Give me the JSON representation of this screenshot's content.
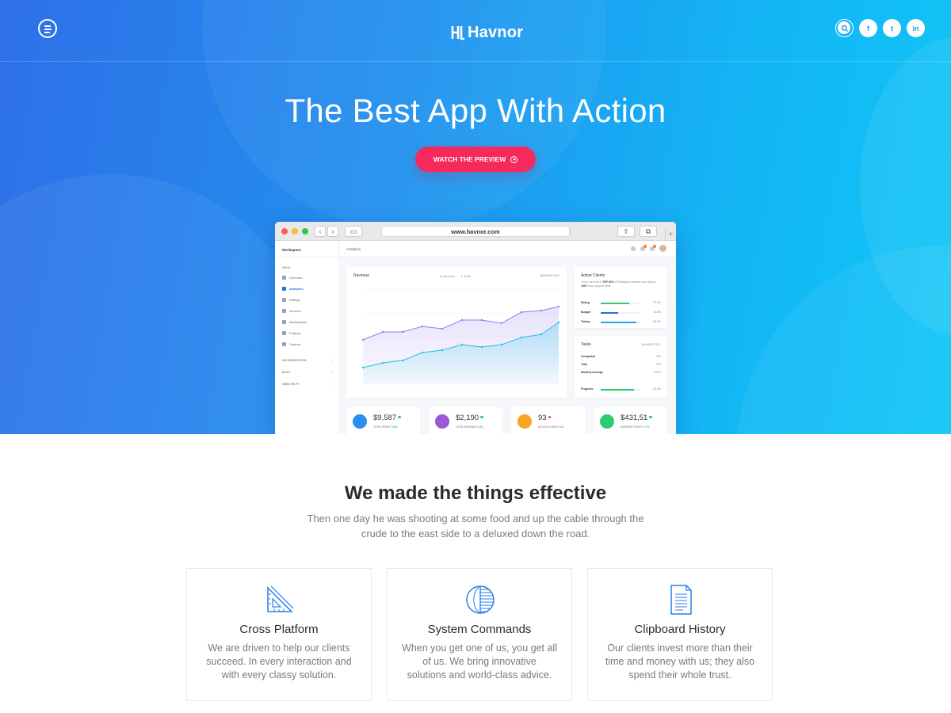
{
  "brand": {
    "name": "Havnor"
  },
  "header": {
    "menu_icon": "hamburger-icon",
    "social": [
      {
        "name": "search",
        "icon": "search-icon",
        "glyph": ""
      },
      {
        "name": "facebook",
        "icon": "facebook-icon",
        "glyph": "f"
      },
      {
        "name": "twitter",
        "icon": "twitter-icon",
        "glyph": "t"
      },
      {
        "name": "linkedin",
        "icon": "linkedin-icon",
        "glyph": "in"
      }
    ]
  },
  "hero": {
    "title": "The Best App With Action",
    "cta_label": "WATCH THE PREVIEW"
  },
  "mockup": {
    "url": "www.havnor.com",
    "workspace": "Workspace",
    "menu_label": "MENU",
    "nav": [
      "Overview",
      "Analytics",
      "Ratings",
      "Invoices",
      "Marketplace",
      "Projects",
      "Support"
    ],
    "active_nav": "Analytics",
    "sections": [
      "DOCUMENTATION",
      "BLOG",
      "NEED HELP?"
    ],
    "page_title": "Analytics",
    "revenue": {
      "title": "Revenue",
      "legend": [
        "Revenue",
        "Profit"
      ],
      "period": "JANUARY 2017"
    },
    "active_clients": {
      "title": "Active Clients",
      "text_pre": "You're currently in",
      "text_bold": "TOP 10%",
      "text_mid": "of Workspace platform your rating is",
      "rating": "4.85",
      "text_post": "Keep up great work!",
      "metrics": [
        {
          "label": "Rating",
          "value": "72.3%",
          "pct": 72.3,
          "color": "#2ecc71"
        },
        {
          "label": "Budget",
          "value": "43.8%",
          "pct": 43.8,
          "color": "#2a6de0"
        },
        {
          "label": "Timing",
          "value": "89.2%",
          "pct": 89.2,
          "color": "#26a6f0"
        }
      ]
    },
    "tasks": {
      "title": "Tasks",
      "period": "JANUARY 2017",
      "rows": [
        {
          "label": "Completed",
          "value": "390"
        },
        {
          "label": "Total",
          "value": "520"
        },
        {
          "label": "Monthly Average",
          "value": "240.5"
        }
      ],
      "progress": {
        "label": "Progress",
        "value": "83.3%",
        "pct": 83.3
      }
    },
    "stats": [
      {
        "value": "$9,587",
        "label": "TOTAL PROFIT",
        "change": "9.8%",
        "color": "#2a8ef0",
        "dot": "#2ecc71",
        "icon": "chart-icon"
      },
      {
        "value": "$2,190",
        "label": "TOTAL REVENUE",
        "change": "2.2%",
        "color": "#9b59d6",
        "dot": "#2ecc71",
        "icon": "pie-icon"
      },
      {
        "value": "93",
        "label": "ACTIVE CLIENTS",
        "change": "1.5",
        "color": "#f6a623",
        "dot": "#f0443e",
        "icon": "user-icon"
      },
      {
        "value": "$431,51",
        "label": "AVERAGE PROFIT",
        "change": "3.7%",
        "color": "#2ecc71",
        "dot": "#2ecc71",
        "icon": "wallet-icon"
      }
    ]
  },
  "features_section": {
    "title": "We made the things effective",
    "text": "Then one day he was shooting at some food and up the cable through the crude to the east side to a deluxed down the road."
  },
  "features": [
    {
      "title": "Cross Platform",
      "text": "We are driven to help our clients succeed. In every interaction and with every classy solution.",
      "icon": "ruler-triangle-icon"
    },
    {
      "title": "System Commands",
      "text": "When you get one of us, you get all of us. We bring innovative solutions and world-class advice.",
      "icon": "globe-half-icon"
    },
    {
      "title": "Clipboard History",
      "text": "Our clients invest more than their time and money with us; they also spend their whole trust.",
      "icon": "document-icon"
    }
  ],
  "colors": {
    "accent": "#f5295b",
    "hero_start": "#2f6fe8",
    "hero_end": "#10c6f7",
    "primary": "#2196f0"
  }
}
